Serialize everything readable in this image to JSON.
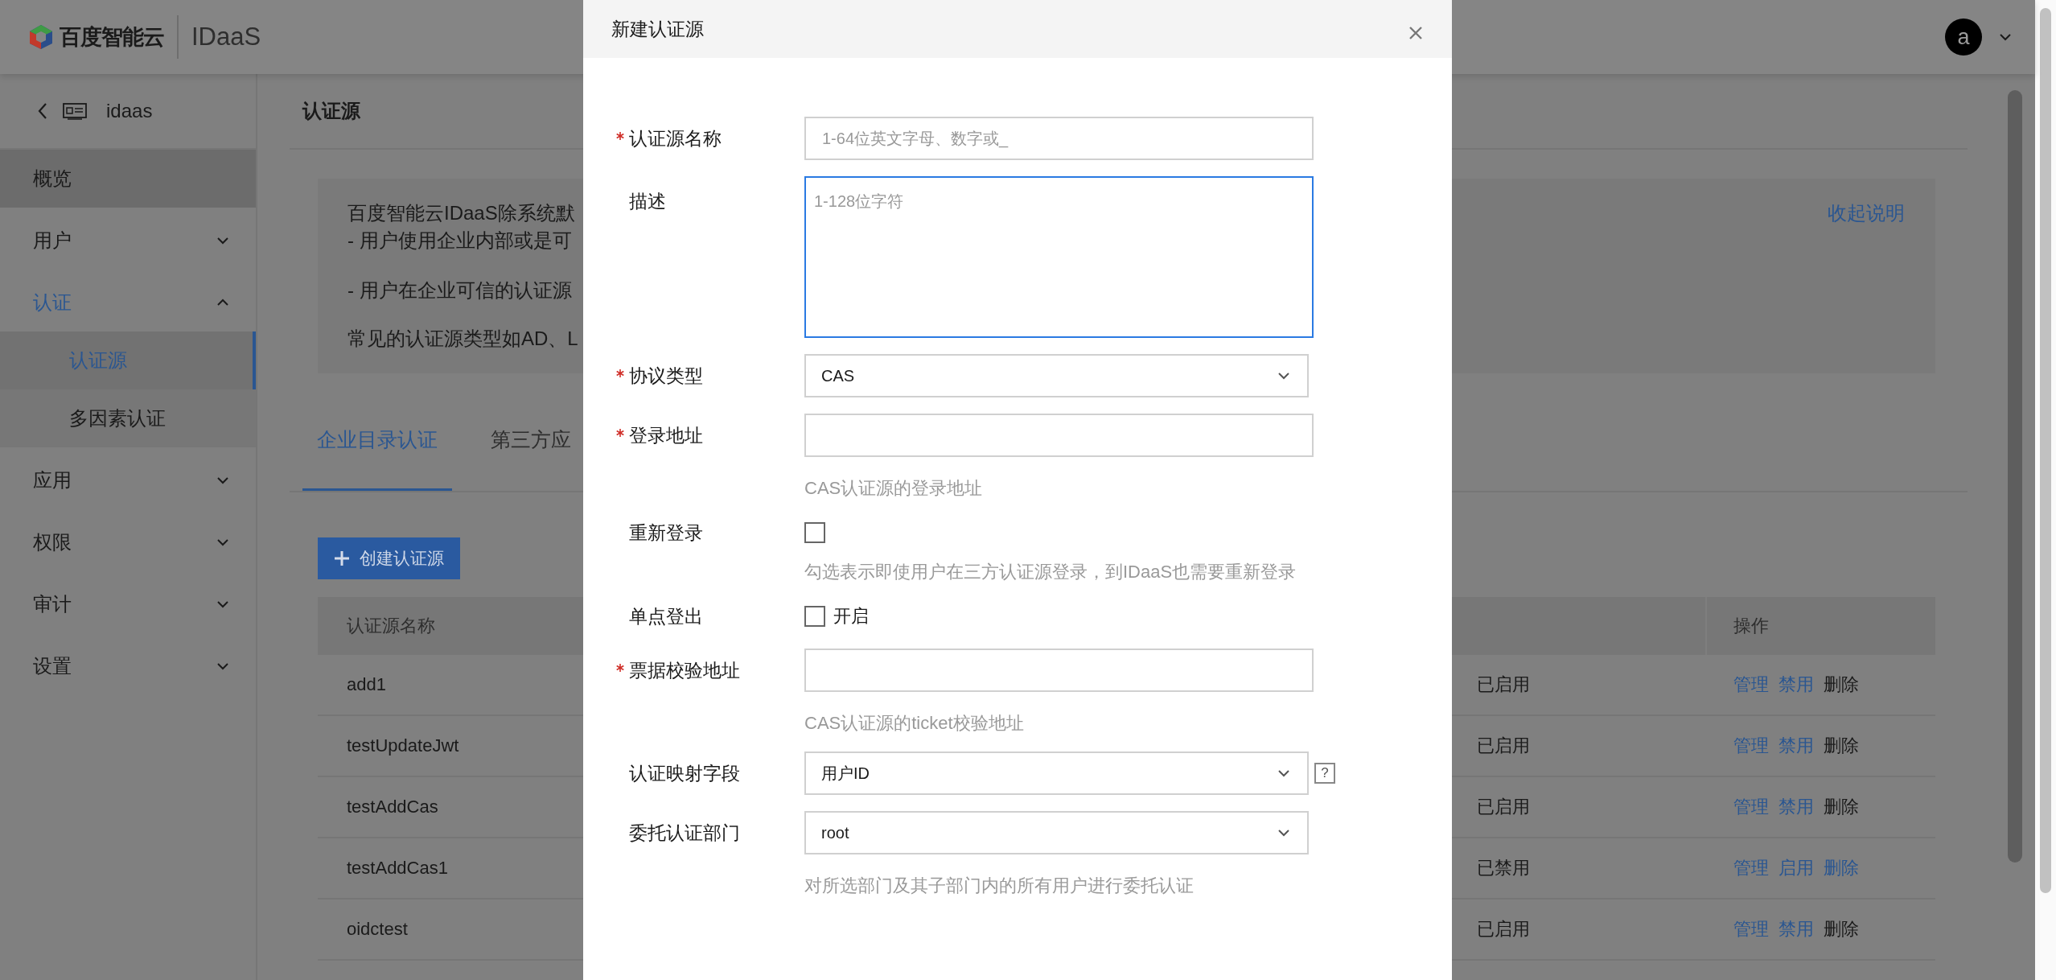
{
  "header": {
    "logo_text": "百度智能云",
    "product": "IDaaS",
    "avatar": "a"
  },
  "sidebar": {
    "back_label": "idaas",
    "items": [
      {
        "label": "概览",
        "kind": "link",
        "highlighted": true,
        "active": false
      },
      {
        "label": "用户",
        "kind": "group",
        "highlighted": false,
        "active": false,
        "expanded": false
      },
      {
        "label": "认证",
        "kind": "group",
        "highlighted": false,
        "active": true,
        "expanded": true,
        "children": [
          {
            "label": "认证源",
            "selected": true
          },
          {
            "label": "多因素认证",
            "selected": false
          }
        ]
      },
      {
        "label": "应用",
        "kind": "group",
        "highlighted": false,
        "active": false,
        "expanded": false
      },
      {
        "label": "权限",
        "kind": "group",
        "highlighted": false,
        "active": false,
        "expanded": false
      },
      {
        "label": "审计",
        "kind": "group",
        "highlighted": false,
        "active": false,
        "expanded": false
      },
      {
        "label": "设置",
        "kind": "group",
        "highlighted": false,
        "active": false,
        "expanded": false
      }
    ]
  },
  "page": {
    "title": "认证源",
    "info": {
      "lines": [
        "百度智能云IDaaS除系统默",
        "- 用户使用企业内部或是可",
        "- 用户在企业可信的认证源",
        "常见的认证源类型如AD、L"
      ],
      "toggle": "收起说明"
    },
    "tabs": [
      {
        "label": "企业目录认证",
        "selected": true
      },
      {
        "label": "第三方应",
        "selected": false
      }
    ],
    "create_button": "创建认证源",
    "table": {
      "columns": [
        "认证源名称",
        "操作"
      ],
      "rows": [
        {
          "name": "add1",
          "status": "已启用",
          "actions": [
            {
              "label": "管理",
              "disabled": false
            },
            {
              "label": "禁用",
              "disabled": false
            },
            {
              "label": "删除",
              "disabled": true
            }
          ]
        },
        {
          "name": "testUpdateJwt",
          "status": "已启用",
          "actions": [
            {
              "label": "管理",
              "disabled": false
            },
            {
              "label": "禁用",
              "disabled": false
            },
            {
              "label": "删除",
              "disabled": true
            }
          ]
        },
        {
          "name": "testAddCas",
          "status": "已启用",
          "actions": [
            {
              "label": "管理",
              "disabled": false
            },
            {
              "label": "禁用",
              "disabled": false
            },
            {
              "label": "删除",
              "disabled": true
            }
          ]
        },
        {
          "name": "testAddCas1",
          "status": "已禁用",
          "actions": [
            {
              "label": "管理",
              "disabled": false
            },
            {
              "label": "启用",
              "disabled": false
            },
            {
              "label": "删除",
              "disabled": false
            }
          ]
        },
        {
          "name": "oidctest",
          "status": "已启用",
          "actions": [
            {
              "label": "管理",
              "disabled": false
            },
            {
              "label": "禁用",
              "disabled": false
            },
            {
              "label": "删除",
              "disabled": true
            }
          ]
        }
      ]
    }
  },
  "modal": {
    "title": "新建认证源",
    "fields": [
      {
        "kind": "input",
        "label": "认证源名称",
        "required": true,
        "focused": false,
        "placeholder": "1-64位英文字母、数字或_"
      },
      {
        "kind": "textarea",
        "label": "描述",
        "required": false,
        "focused": true,
        "placeholder": "1-128位字符"
      },
      {
        "kind": "select",
        "label": "协议类型",
        "required": true,
        "focused": false,
        "value": "CAS"
      },
      {
        "kind": "input",
        "label": "登录地址",
        "required": true,
        "focused": false,
        "hint": "CAS认证源的登录地址"
      },
      {
        "kind": "checkbox",
        "label": "重新登录",
        "required": false,
        "checked": false,
        "hint": "勾选表示即使用户在三方认证源登录，到IDaaS也需要重新登录"
      },
      {
        "kind": "checkbox",
        "label": "单点登出",
        "required": false,
        "checked": false,
        "text": "开启"
      },
      {
        "kind": "input",
        "label": "票据校验地址",
        "required": true,
        "focused": false,
        "hint": "CAS认证源的ticket校验地址"
      },
      {
        "kind": "select",
        "label": "认证映射字段",
        "required": false,
        "focused": false,
        "value": "用户ID",
        "help": "?"
      },
      {
        "kind": "select",
        "label": "委托认证部门",
        "required": false,
        "focused": false,
        "value": "root",
        "hint": "对所选部门及其子部门内的所有用户进行委托认证"
      }
    ]
  }
}
